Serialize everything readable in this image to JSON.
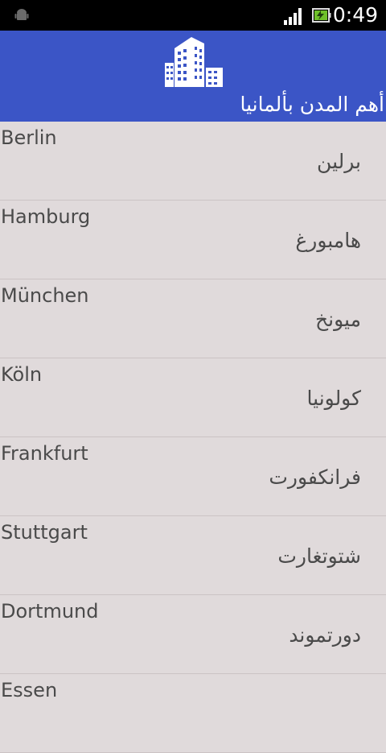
{
  "status_bar": {
    "time": "0:49",
    "icons": [
      "android-debug-icon",
      "signal-icon",
      "battery-charging-icon"
    ]
  },
  "header": {
    "logo_icon": "buildings-icon",
    "title": "أهم المدن بألمانيا",
    "background": "#3b55c6"
  },
  "cities": [
    {
      "en": "Berlin",
      "ar": "برلين"
    },
    {
      "en": "Hamburg",
      "ar": "هامبورغ"
    },
    {
      "en": "München",
      "ar": "ميونخ"
    },
    {
      "en": "Köln",
      "ar": "كولونيا"
    },
    {
      "en": "Frankfurt",
      "ar": "فرانكفورت"
    },
    {
      "en": "Stuttgart",
      "ar": "شتوتغارت"
    },
    {
      "en": "Dortmund",
      "ar": "دورتموند"
    },
    {
      "en": "Essen",
      "ar": ""
    }
  ]
}
